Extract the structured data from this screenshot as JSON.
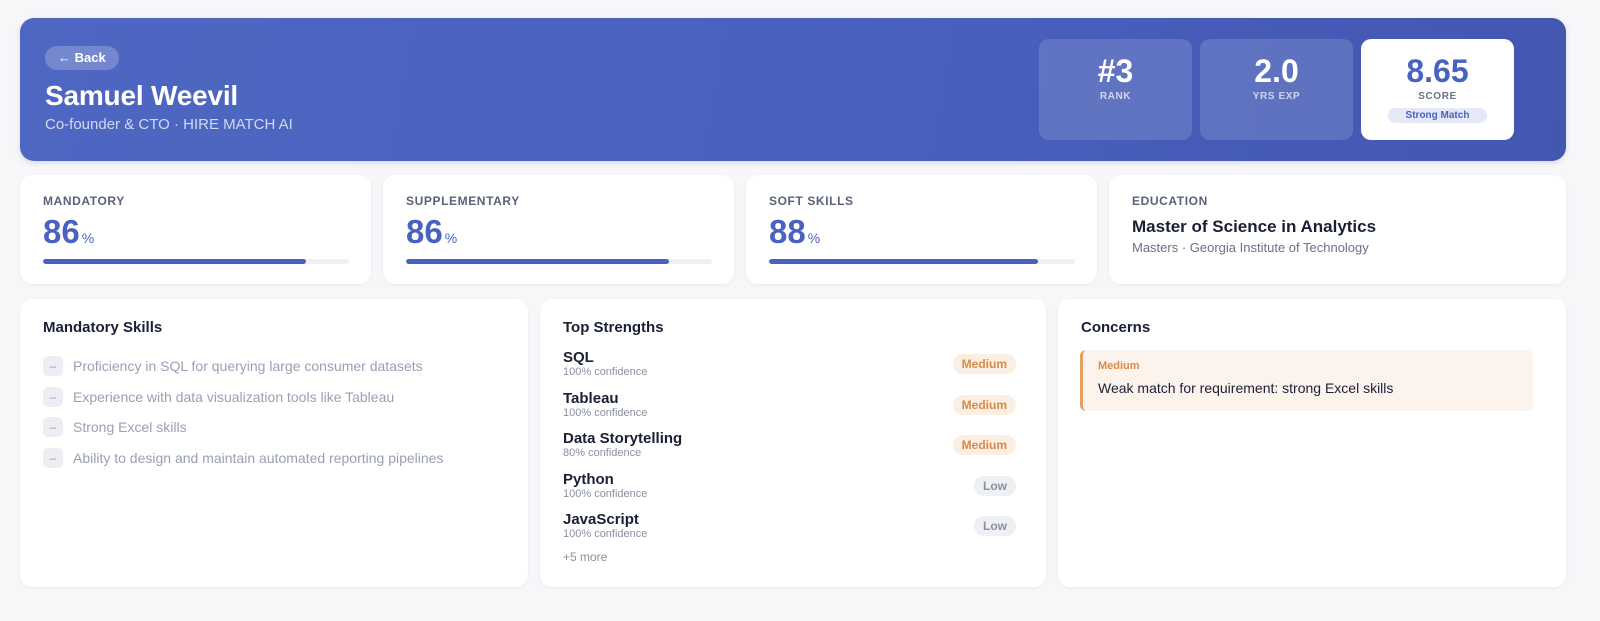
{
  "header": {
    "back_label": "← Back",
    "name": "Samuel Weevil",
    "subtitle": "Co-founder & CTO · HIRE MATCH AI",
    "stats": {
      "rank": {
        "value": "#3",
        "label": "RANK"
      },
      "experience": {
        "value": "2.0",
        "label": "YRS EXP"
      },
      "score": {
        "value": "8.65",
        "label": "SCORE",
        "badge": "Strong Match"
      }
    }
  },
  "metrics": [
    {
      "label": "MANDATORY",
      "value": "86",
      "unit": "%",
      "fill": 86
    },
    {
      "label": "SUPPLEMENTARY",
      "value": "86",
      "unit": "%",
      "fill": 86
    },
    {
      "label": "SOFT SKILLS",
      "value": "88",
      "unit": "%",
      "fill": 88
    }
  ],
  "education": {
    "label": "EDUCATION",
    "degree": "Master of Science in Analytics",
    "detail": "Masters · Georgia Institute of Technology"
  },
  "mandatory_skills": {
    "title": "Mandatory Skills",
    "bullet": "–",
    "items": [
      "Proficiency in SQL for querying large consumer datasets",
      "Experience with data visualization tools like Tableau",
      "Strong Excel skills",
      "Ability to design and maintain automated reporting pipelines"
    ]
  },
  "strengths": {
    "title": "Top Strengths",
    "items": [
      {
        "name": "SQL",
        "confidence": "100% confidence",
        "level": "Medium"
      },
      {
        "name": "Tableau",
        "confidence": "100% confidence",
        "level": "Medium"
      },
      {
        "name": "Data Storytelling",
        "confidence": "80% confidence",
        "level": "Medium"
      },
      {
        "name": "Python",
        "confidence": "100% confidence",
        "level": "Low"
      },
      {
        "name": "JavaScript",
        "confidence": "100% confidence",
        "level": "Low"
      }
    ],
    "more": "+5 more"
  },
  "concerns": {
    "title": "Concerns",
    "items": [
      {
        "severity": "Medium",
        "text": "Weak match for requirement: strong Excel skills"
      }
    ]
  },
  "colors": {
    "accent": "#4a62bf",
    "medium": "#d98a45",
    "low": "#8a90a0"
  }
}
